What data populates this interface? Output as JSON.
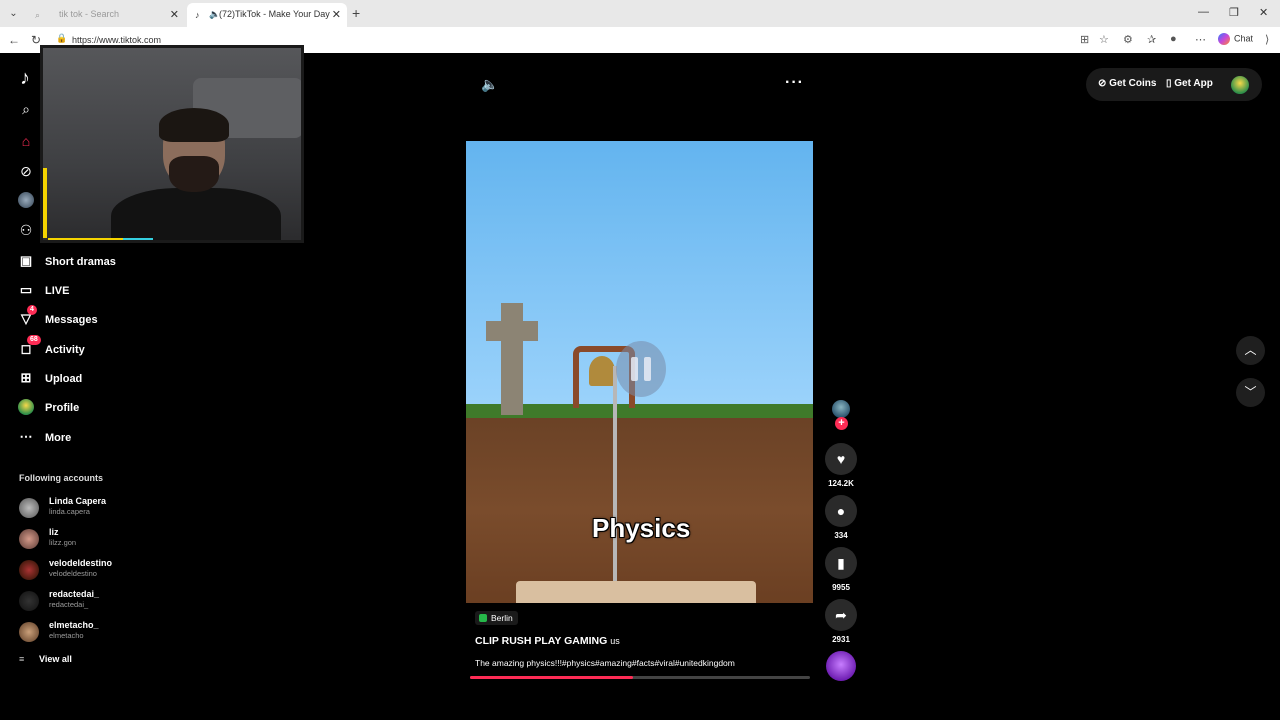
{
  "browser": {
    "tabs": [
      {
        "title": "tik tok - Search",
        "active": false
      },
      {
        "title": "(72)TikTok - Make Your Day",
        "active": true
      }
    ],
    "url": "https://www.tiktok.com",
    "chat_label": "Chat"
  },
  "sidebar": {
    "items": [
      {
        "label": "Short dramas",
        "icon": "film-icon"
      },
      {
        "label": "LIVE",
        "icon": "live-icon"
      },
      {
        "label": "Messages",
        "icon": "messages-icon",
        "badge": "4"
      },
      {
        "label": "Activity",
        "icon": "activity-icon",
        "badge": "68"
      },
      {
        "label": "Upload",
        "icon": "upload-icon"
      },
      {
        "label": "Profile",
        "icon": "profile-avatar"
      },
      {
        "label": "More",
        "icon": "more-icon"
      }
    ],
    "following_title": "Following accounts",
    "following": [
      {
        "name": "Linda Capera",
        "handle": "linda.capera"
      },
      {
        "name": "liz",
        "handle": "lilzz.gon"
      },
      {
        "name": "velodeldestino",
        "handle": "velodeldestino"
      },
      {
        "name": "redactedai_",
        "handle": "redactedai_"
      },
      {
        "name": "elmetacho_",
        "handle": "elmetacho"
      }
    ],
    "view_all": "View all"
  },
  "header": {
    "get_coins": "Get Coins",
    "get_app": "Get App"
  },
  "video": {
    "overlay_text": "Physics",
    "location": "Berlin",
    "creator": "CLIP RUSH PLAY GAMING",
    "creator_country": "us",
    "caption": "The amazing physics!!!#physics#amazing#facts#viral#unitedkingdom",
    "progress": 0.48
  },
  "actions": {
    "likes": "124.2K",
    "comments": "334",
    "saves": "9955",
    "shares": "2931"
  },
  "colors": {
    "accent": "#fe2c55",
    "background": "#000000",
    "location_pin": "#26b84a"
  }
}
